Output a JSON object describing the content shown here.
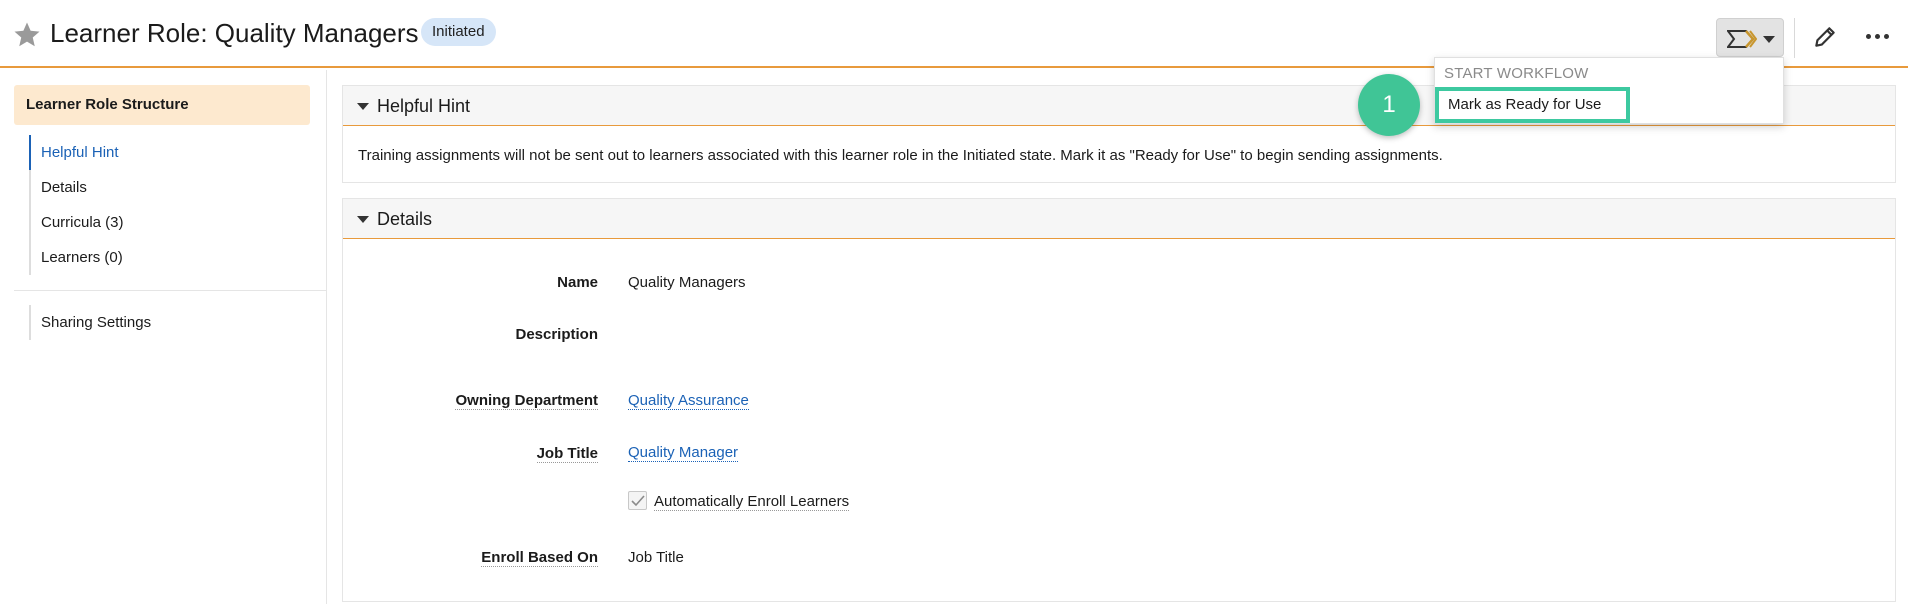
{
  "header": {
    "title": "Learner Role: Quality Managers",
    "status_badge": "Initiated"
  },
  "workflow_menu": {
    "header": "START WORKFLOW",
    "items": [
      {
        "label": "Mark as Ready for Use"
      }
    ]
  },
  "step_marker": "1",
  "sidebar": {
    "title": "Learner Role Structure",
    "items": [
      {
        "label": "Helpful Hint",
        "active": true
      },
      {
        "label": "Details"
      },
      {
        "label": "Curricula (3)"
      },
      {
        "label": "Learners (0)"
      }
    ],
    "secondary_items": [
      {
        "label": "Sharing Settings"
      }
    ]
  },
  "hint_panel": {
    "title": "Helpful Hint",
    "text": "Training assignments will not be sent out to learners associated with this learner role in the Initiated state. Mark it as \"Ready for Use\" to begin sending assignments."
  },
  "details_panel": {
    "title": "Details",
    "fields": {
      "name_label": "Name",
      "name_value": "Quality Managers",
      "description_label": "Description",
      "description_value": "",
      "owning_department_label": "Owning Department",
      "owning_department_value": "Quality Assurance",
      "job_title_label": "Job Title",
      "job_title_value": "Quality Manager",
      "auto_enroll_label": "Automatically Enroll Learners",
      "auto_enroll_checked": true,
      "enroll_based_on_label": "Enroll Based On",
      "enroll_based_on_value": "Job Title"
    }
  },
  "colors": {
    "accent_orange": "#e89a3c",
    "link_blue": "#1b62b6",
    "badge_bg": "#d6e6f8",
    "highlight_green": "#3dc9a0",
    "step_green": "#40c596",
    "sidebar_title_bg": "#fde9cf"
  },
  "icons": [
    "star-icon",
    "workflow-icon",
    "chevron-down-icon",
    "pencil-icon",
    "more-icon",
    "triangle-down-icon",
    "check-icon"
  ]
}
